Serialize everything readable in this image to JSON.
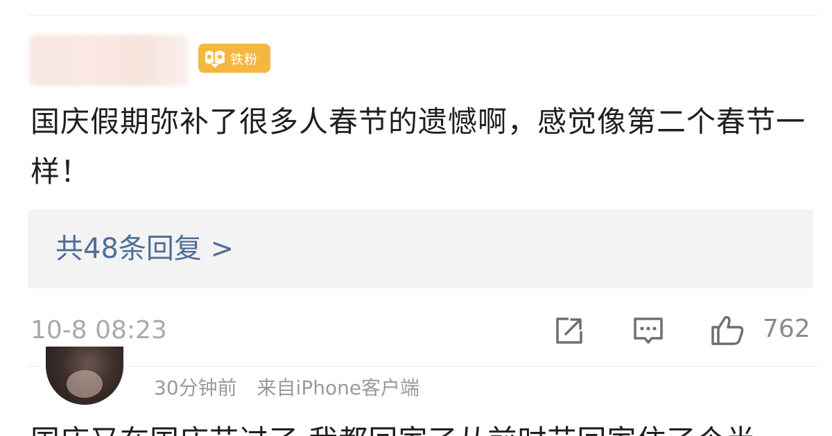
{
  "comment": {
    "badge": {
      "icon": "fan-badge-icon",
      "label": "铁粉",
      "color": "#f4b840"
    },
    "text": "国庆假期弥补了很多人春节的遗憾啊，感觉像第二个春节一样！",
    "replies_label": "共48条回复 >",
    "timestamp": "10-8 08:23",
    "actions": {
      "share_icon": "share-icon",
      "comment_icon": "comment-icon",
      "like_icon": "thumbs-up-icon",
      "like_count": "762"
    }
  },
  "next_comment": {
    "time_ago": "30分钟前",
    "source": "来自iPhone客户端",
    "text_peek": "国庆又在国庆节过了 我都回家了从前时节回家住了个半天"
  },
  "colors": {
    "link": "#4e6e98",
    "meta_gray": "#a9a9a9",
    "reply_box_bg": "#f3f3f3"
  }
}
